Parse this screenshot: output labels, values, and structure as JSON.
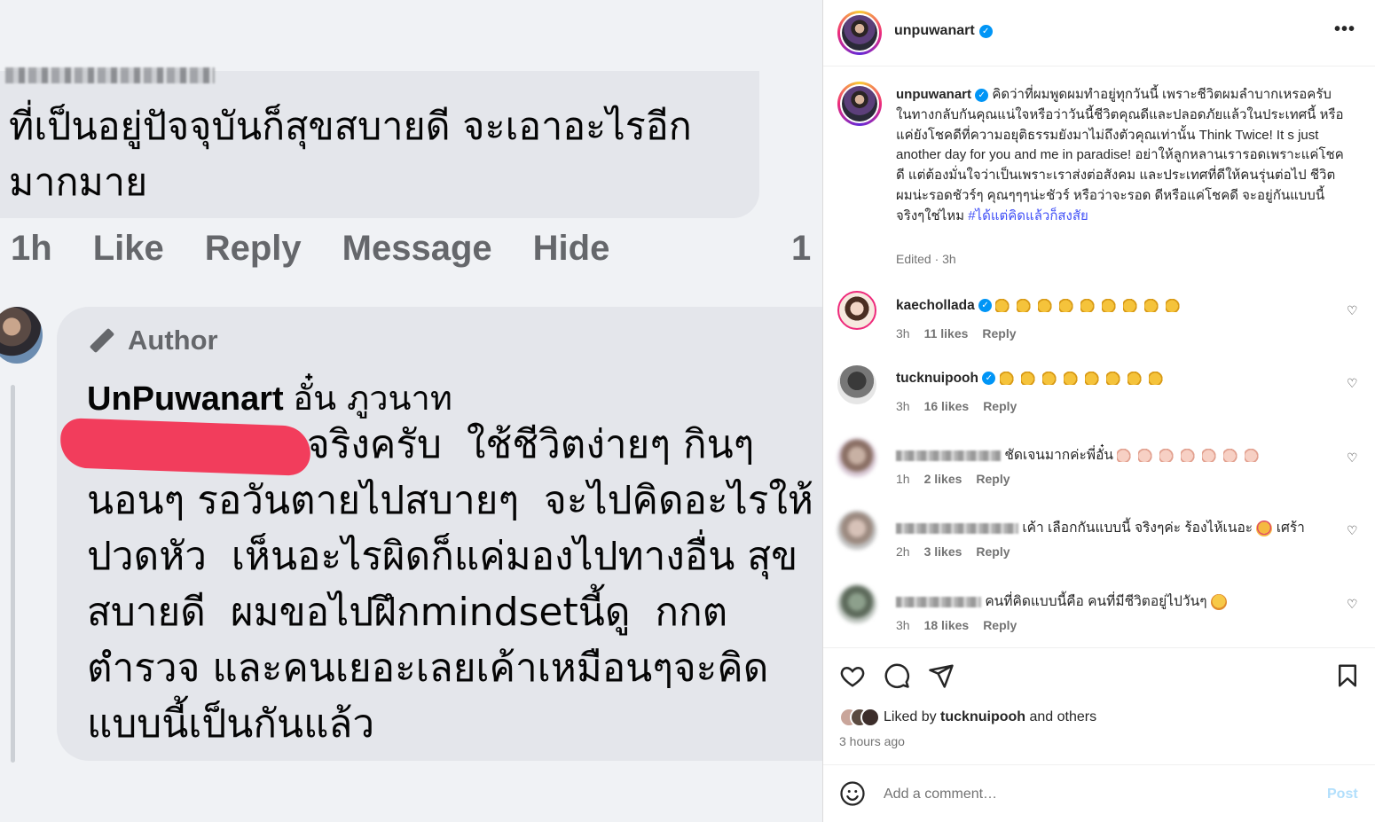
{
  "left_image": {
    "comment1_text": "ที่เป็นอยู่ปัจจุบันก็สุขสบายดี จะเอาอะไรอีกมากมาย",
    "actions": [
      "1h",
      "Like",
      "Reply",
      "Message",
      "Hide"
    ],
    "reply_count": "1",
    "author_label": "Author",
    "reply_name": "UnPuwanart",
    "reply_name_thai": "อั๋น ภูวนาท",
    "reply_text": "จริงครับ  ใช้ชีวิตง่ายๆ กินๆ นอนๆ รอวันตายไปสบายๆ  จะไปคิดอะไรให้ปวดหัว  เห็นอะไรผิดก็แค่มองไปทางอื่น สุขสบายดี  ผมขอไปฝึกmindsetนี้ดู  กกต ตำรวจ และคนเยอะเลยเค้าเหมือนๆจะคิดแบบนี้เป็นกันแล้ว"
  },
  "post": {
    "username": "unpuwanart",
    "more_icon": "more-dots-icon",
    "caption_user": "unpuwanart",
    "caption_text": "คิดว่าที่ผมพูดผมทำอยู่ทุกวันนี้ เพราะชีวิตผมลำบากเหรอครับ ในทางกลับกันคุณแน่ใจหรือว่าวันนี้ชีวิตคุณดีและปลอดภัยแล้วในประเทศนี้ หรือแค่ยังโชคดีที่ความอยุติธรรมยังมาไม่ถึงตัวคุณเท่านั้น Think Twice! It s just another day for you and me in paradise! อย่าให้ลูกหลานเรารอดเพราะแค่โชคดี แต่ต้องมั่นใจว่าเป็นเพราะเราส่งต่อสังคม และประเทศที่ดีให้คนรุ่นต่อไป ชีวิตผมน่ะรอดชัวร์ๆ คุณๆๆๆน่ะชัวร์ หรือว่าจะรอด ดีหรือแค่โชคดี จะอยู่กันแบบนี้จริงๆใช่ไหม ",
    "caption_tag": "#ได้แต่คิดแล้วก็สงสัย",
    "edited": "Edited · 3h"
  },
  "comments": [
    {
      "user": "kaechollada",
      "text": "",
      "time": "3h",
      "likes": "11 likes",
      "reply": "Reply"
    },
    {
      "user": "tucknuipooh",
      "text": "",
      "time": "3h",
      "likes": "16 likes",
      "reply": "Reply"
    },
    {
      "user": "",
      "text": "ชัดเจนมากค่ะพี่อั๋น",
      "time": "1h",
      "likes": "2 likes",
      "reply": "Reply"
    },
    {
      "user": "",
      "text": "เค้า เลือกกันแบบนี้ จริงๆค่ะ ร้องไห้เนอะ",
      "text2": "เศร้า",
      "time": "2h",
      "likes": "3 likes",
      "reply": "Reply"
    },
    {
      "user": "",
      "text": "คนที่คิดแบบนี้คือ คนที่มีชีวิตอยู่ไปวันๆ",
      "time": "3h",
      "likes": "18 likes",
      "reply": "Reply"
    }
  ],
  "actions_bar": {
    "icons": [
      "heart-icon",
      "comment-icon",
      "share-icon",
      "bookmark-icon"
    ]
  },
  "liked_by_prefix": "Liked by ",
  "liked_by_user": "tucknuipooh",
  "liked_by_suffix": " and others",
  "post_time": "3 hours ago",
  "add_comment_placeholder": "Add a comment…",
  "post_button": "Post"
}
